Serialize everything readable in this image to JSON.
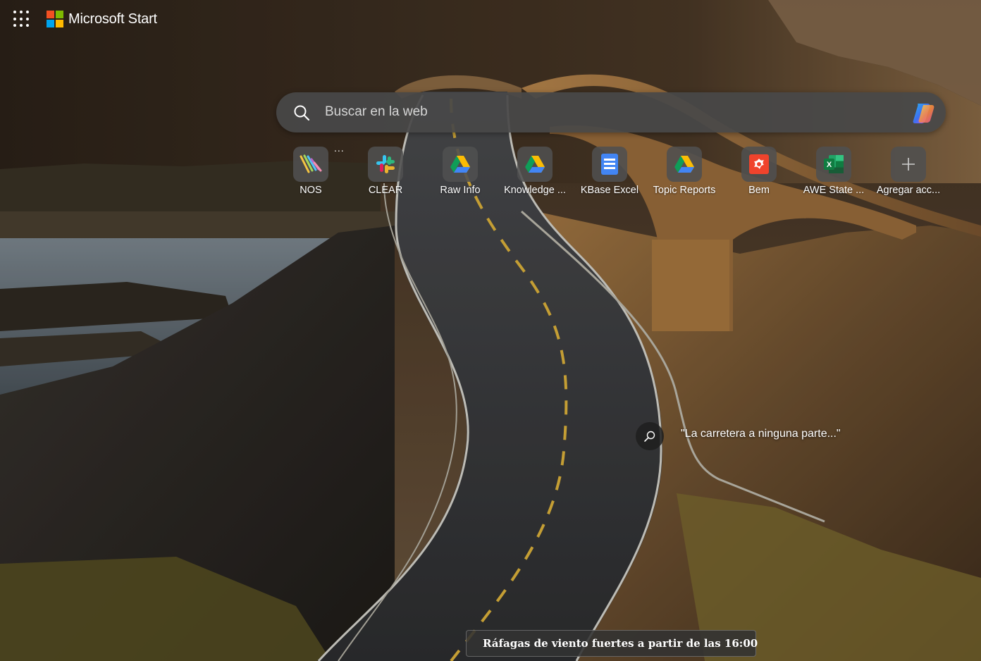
{
  "header": {
    "apps_icon": "waffle-grid-icon",
    "brand_name": "Microsoft Start",
    "logo_colors": [
      "#f25022",
      "#7fba00",
      "#00a4ef",
      "#ffb900"
    ]
  },
  "search": {
    "placeholder": "Buscar en la web",
    "icon": "search-icon",
    "copilot_icon": "copilot-icon"
  },
  "quick_links": [
    {
      "label": "NOS",
      "icon": "nos-icon"
    },
    {
      "label": "CLEAR",
      "icon": "slack-icon"
    },
    {
      "label": "Raw Info",
      "icon": "google-drive-icon"
    },
    {
      "label": "Knowledge ...",
      "icon": "google-drive-icon"
    },
    {
      "label": "KBase Excel",
      "icon": "google-docs-icon"
    },
    {
      "label": "Topic Reports",
      "icon": "google-drive-icon"
    },
    {
      "label": "Bem",
      "icon": "bem-icon"
    },
    {
      "label": "AWE State ...",
      "icon": "excel-icon"
    },
    {
      "label": "Agregar acc...",
      "icon": "plus-icon"
    }
  ],
  "tile_more": "...",
  "background_caption": {
    "icon": "image-search-icon",
    "text": "\"La carretera a ninguna parte...\""
  },
  "weather_alert": {
    "icon": "wind-icon",
    "text": "Ráfagas de viento fuertes a partir de las 16:00"
  }
}
